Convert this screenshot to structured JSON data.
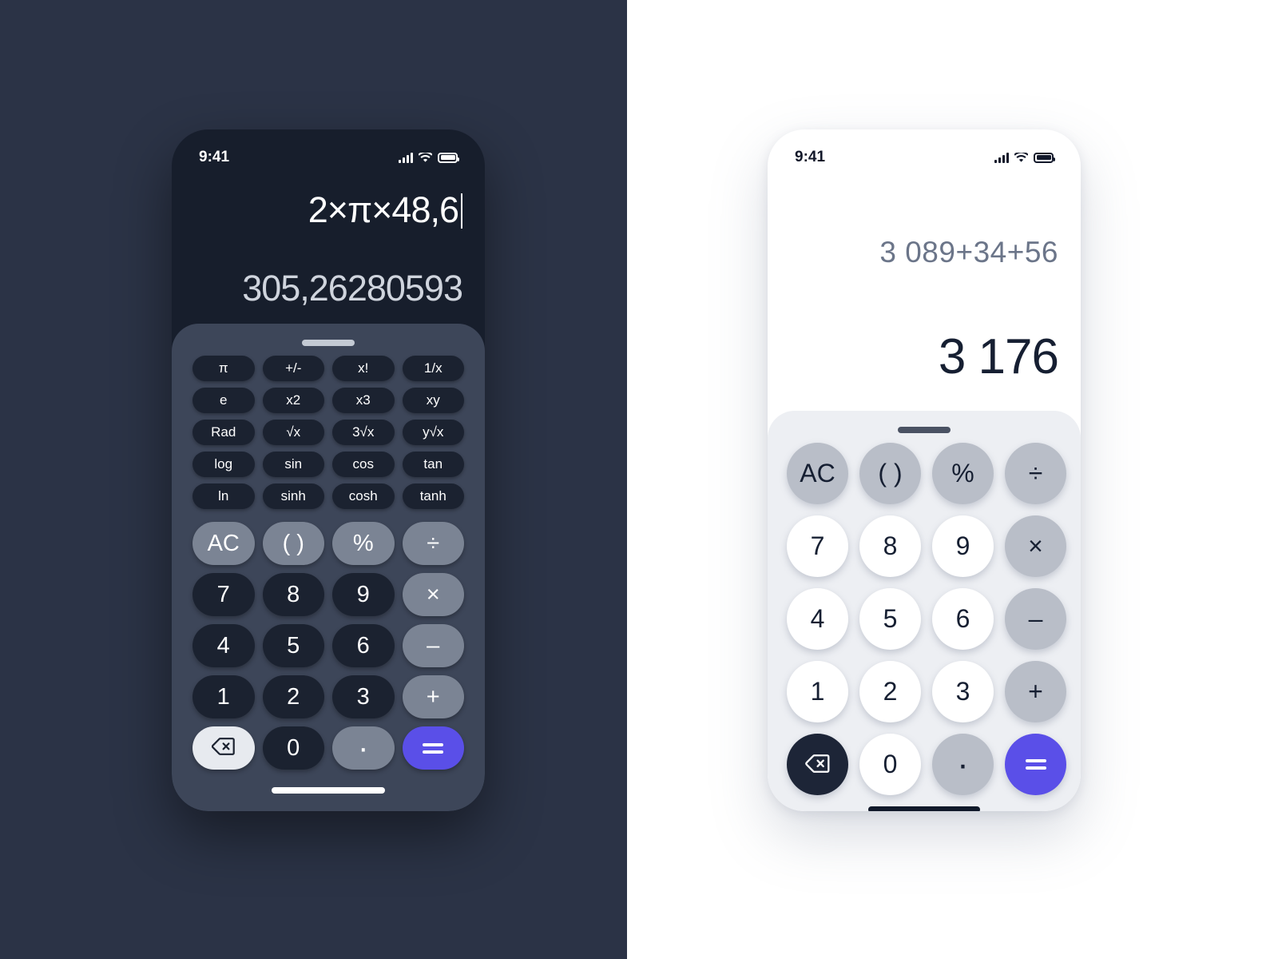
{
  "colors": {
    "left_background": "#2b3346",
    "right_background": "#ffffff",
    "dark_screen": "#171e2c",
    "dark_sheet": "#3d4659",
    "light_sheet": "#edeff3",
    "accent_equals": "#5a4fe8",
    "function_key_dark": "#7b8494",
    "function_key_light": "#b9bec8",
    "number_key_dark": "#1b2230",
    "number_key_light": "#ffffff"
  },
  "dark_phone": {
    "status_bar": {
      "time": "9:41",
      "signal_icon": "cellular-bars-icon",
      "wifi_icon": "wifi-icon",
      "battery_icon": "battery-icon"
    },
    "display": {
      "expression": "2×π×48,6",
      "result": "305,26280593",
      "caret_visible": true
    },
    "grabber": "drag-handle",
    "scientific_keys": [
      "π",
      "+/-",
      "x!",
      "1/x",
      "e",
      "x2",
      "x3",
      "xy",
      "Rad",
      "√x",
      "3√x",
      "y√x",
      "log",
      "sin",
      "cos",
      "tan",
      "ln",
      "sinh",
      "cosh",
      "tanh"
    ],
    "keypad": [
      {
        "label": "AC",
        "type": "fn"
      },
      {
        "label": "( )",
        "type": "fn"
      },
      {
        "label": "%",
        "type": "fn"
      },
      {
        "label": "÷",
        "type": "fn"
      },
      {
        "label": "7",
        "type": "num"
      },
      {
        "label": "8",
        "type": "num"
      },
      {
        "label": "9",
        "type": "num"
      },
      {
        "label": "×",
        "type": "fn"
      },
      {
        "label": "4",
        "type": "num"
      },
      {
        "label": "5",
        "type": "num"
      },
      {
        "label": "6",
        "type": "num"
      },
      {
        "label": "–",
        "type": "fn"
      },
      {
        "label": "1",
        "type": "num"
      },
      {
        "label": "2",
        "type": "num"
      },
      {
        "label": "3",
        "type": "num"
      },
      {
        "label": "+",
        "type": "fn"
      },
      {
        "label": "",
        "type": "delete"
      },
      {
        "label": "0",
        "type": "num"
      },
      {
        "label": "·",
        "type": "dot"
      },
      {
        "label": "=",
        "type": "equals"
      }
    ],
    "home_indicator": "home-indicator"
  },
  "light_phone": {
    "status_bar": {
      "time": "9:41",
      "signal_icon": "cellular-bars-icon",
      "wifi_icon": "wifi-icon",
      "battery_icon": "battery-icon"
    },
    "display": {
      "expression": "3 089+34+56",
      "result": "3 176"
    },
    "grabber": "drag-handle",
    "keypad": [
      {
        "label": "AC",
        "type": "fn"
      },
      {
        "label": "( )",
        "type": "fn"
      },
      {
        "label": "%",
        "type": "fn"
      },
      {
        "label": "÷",
        "type": "fn"
      },
      {
        "label": "7",
        "type": "num"
      },
      {
        "label": "8",
        "type": "num"
      },
      {
        "label": "9",
        "type": "num"
      },
      {
        "label": "×",
        "type": "fn"
      },
      {
        "label": "4",
        "type": "num"
      },
      {
        "label": "5",
        "type": "num"
      },
      {
        "label": "6",
        "type": "num"
      },
      {
        "label": "–",
        "type": "fn"
      },
      {
        "label": "1",
        "type": "num"
      },
      {
        "label": "2",
        "type": "num"
      },
      {
        "label": "3",
        "type": "num"
      },
      {
        "label": "+",
        "type": "fn"
      },
      {
        "label": "",
        "type": "delete"
      },
      {
        "label": "0",
        "type": "num"
      },
      {
        "label": "·",
        "type": "dot"
      },
      {
        "label": "=",
        "type": "equals"
      }
    ],
    "home_indicator": "home-indicator"
  }
}
